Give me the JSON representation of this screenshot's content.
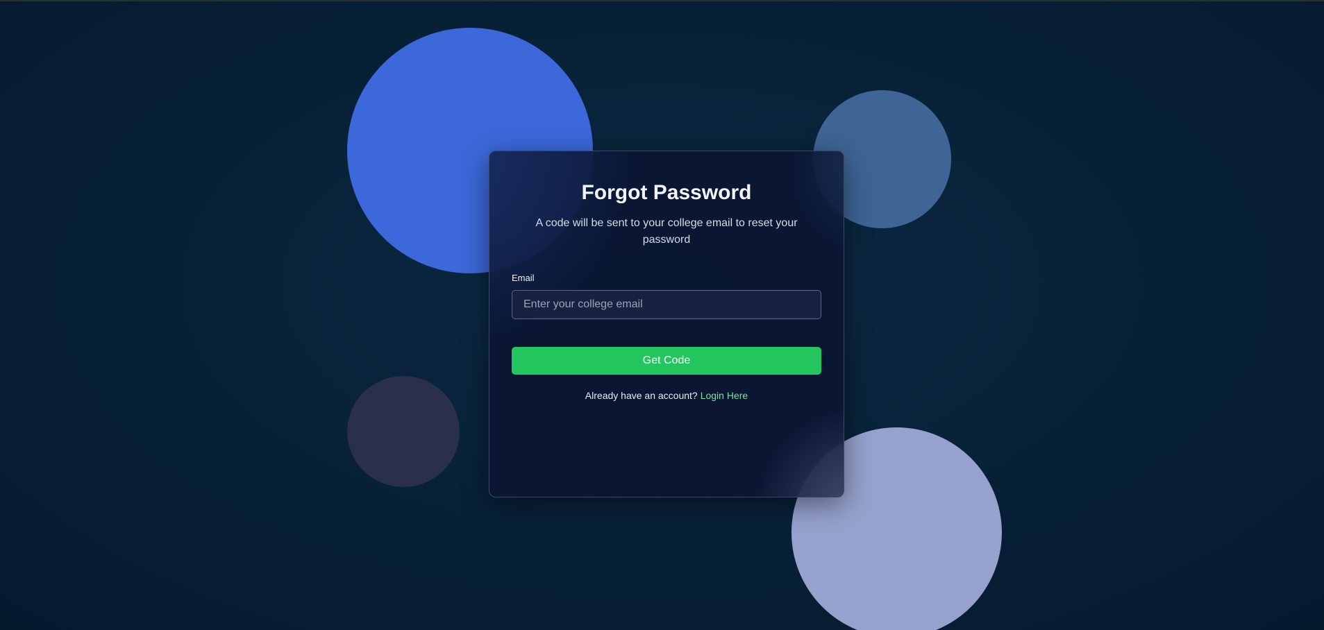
{
  "page": {
    "background_color": "#082036",
    "accent_color": "#22c55e"
  },
  "decor": {
    "blob_colors": [
      "#3c68d9",
      "#3f6596",
      "#2a2f4b",
      "#96a2cd"
    ]
  },
  "form": {
    "title": "Forgot Password",
    "subtitle": "A code will be sent to your college email to reset your password",
    "email_label": "Email",
    "email_value": "",
    "email_placeholder": "Enter your college email",
    "submit_label": "Get Code",
    "footer_text": "Already have an account?",
    "login_link_label": "Login Here"
  }
}
